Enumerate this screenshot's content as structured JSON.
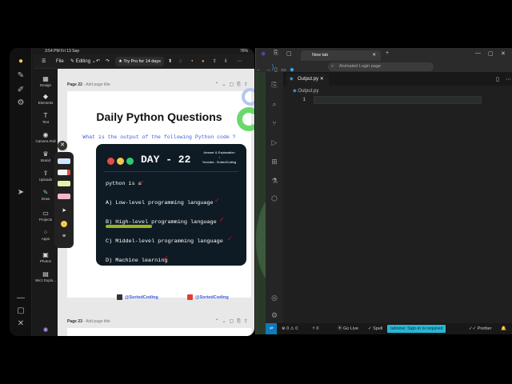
{
  "ipad": {
    "status": {
      "time": "3:54 PM",
      "date": "Fri 13 Sep",
      "battery": "76%"
    },
    "canva": {
      "menu": {
        "file": "File",
        "editing": "Editing",
        "try_pro": "Try Pro for 14 days"
      },
      "sidebar": [
        {
          "icon": "design-icon",
          "label": "Design"
        },
        {
          "icon": "elements-icon",
          "label": "Elements"
        },
        {
          "icon": "text-icon",
          "label": "Text"
        },
        {
          "icon": "camera-roll-icon",
          "label": "Camera Roll"
        },
        {
          "icon": "brand-icon",
          "label": "Brand"
        },
        {
          "icon": "uploads-icon",
          "label": "Uploads"
        },
        {
          "icon": "draw-icon",
          "label": "Draw"
        },
        {
          "icon": "projects-icon",
          "label": "Projects"
        },
        {
          "icon": "apps-icon",
          "label": "Apps"
        },
        {
          "icon": "photos-icon",
          "label": "Photos"
        },
        {
          "icon": "wicz-icon",
          "label": "Wicz Explo..."
        }
      ],
      "page22": {
        "label": "Page 22",
        "add_title": "- Add page title"
      },
      "page23": {
        "label": "Page 23",
        "add_title": "- Add page title"
      }
    },
    "post": {
      "title": "Daily Python Questions",
      "subtitle": "What is the output of the following Python code ?",
      "day": "DAY - 22",
      "answer_line1": "Answer & Explanation",
      "answer_line2": "Youtube:- SortedCoding",
      "question": "python is a",
      "options": [
        "A) Low-level programming language",
        "B) High-level programming language",
        "C) Middel-level programming language",
        "D) Machine learning"
      ],
      "social": {
        "instagram": "@SortedCoding",
        "youtube": "@SortedCoding"
      },
      "colors": {
        "card": "#0f1b24",
        "accent_red": "#d11111",
        "accent_blue": "#3b5bdb"
      }
    }
  },
  "browser": {
    "tab_title": "New tab",
    "search_text": "Animated Login page"
  },
  "vscode": {
    "file_tab": "Output.py",
    "breadcrumb": "Output.py",
    "line_number": "1",
    "status": {
      "errors": "0",
      "warnings": "0",
      "ports": "0",
      "golive": "Go Live",
      "spell": "Spell",
      "sign_in": "tabnine: Sign-in is required",
      "prettier": "Prettier"
    }
  }
}
